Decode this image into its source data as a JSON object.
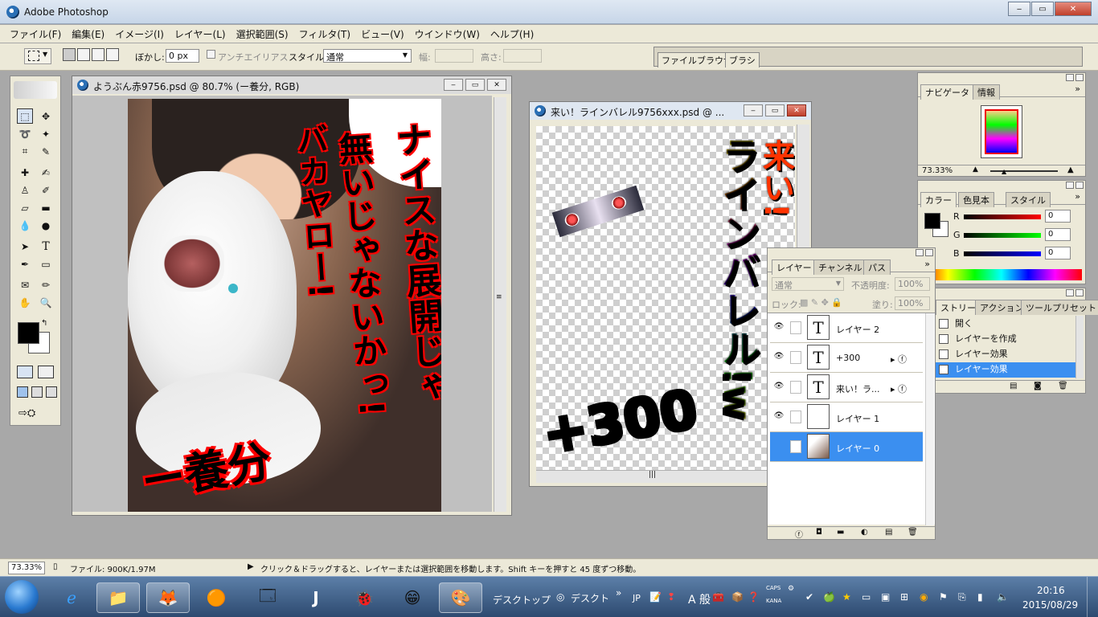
{
  "app": {
    "title": "Adobe Photoshop"
  },
  "menu": [
    "ファイル(F)",
    "編集(E)",
    "イメージ(I)",
    "レイヤー(L)",
    "選択範囲(S)",
    "フィルタ(T)",
    "ビュー(V)",
    "ウインドウ(W)",
    "ヘルプ(H)"
  ],
  "options": {
    "feather_label": "ぼかし:",
    "feather_value": "0 px",
    "antialias": "アンチエイリアス",
    "style_label": "スタイル:",
    "style_value": "通常",
    "width_label": "幅:",
    "height_label": "高さ:"
  },
  "palette_well": {
    "tab1": "ファイルブラウザ",
    "tab2": "ブラシ"
  },
  "doc1": {
    "title": "ようぶん赤9756.psd @ 80.7% (ー養分, RGB)",
    "text_main": "ナイスな展開じゃ",
    "text_2": "無いじゃないかっ!",
    "text_3": "バカヤロー!",
    "text_bottom": "ー養分"
  },
  "doc2": {
    "title": "来い！ラインバレル9756xxx.psd @ ...",
    "text_1": "来い!",
    "text_2": "ラインバレル!w",
    "text_3": "+300"
  },
  "navigator": {
    "tab1": "ナビゲータ",
    "tab2": "情報",
    "zoom": "73.33%"
  },
  "color": {
    "tab1": "カラー",
    "tab2": "色見本",
    "tab3": "スタイル",
    "r_label": "R",
    "g_label": "G",
    "b_label": "B",
    "r": "0",
    "g": "0",
    "b": "0"
  },
  "history": {
    "tab1": "ストリー",
    "tab2": "アクション",
    "tab3": "ツールプリセット",
    "items": [
      "開く",
      "レイヤーを作成",
      "レイヤー効果",
      "レイヤー効果"
    ]
  },
  "layers": {
    "tab1": "レイヤー",
    "tab2": "チャンネル",
    "tab3": "パス",
    "blend": "通常",
    "opacity_label": "不透明度:",
    "opacity": "100%",
    "lock_label": "ロック:",
    "fill_label": "塗り:",
    "fill": "100%",
    "items": [
      {
        "name": "レイヤー 2",
        "thumb": "T"
      },
      {
        "name": "+300",
        "thumb": "T"
      },
      {
        "name": "来い！ラ...",
        "thumb": "T"
      },
      {
        "name": "レイヤー 1",
        "thumb": ""
      },
      {
        "name": "レイヤー 0",
        "thumb": ""
      }
    ]
  },
  "status": {
    "zoom": "73.33%",
    "file": "ファイル: 900K/1.97M",
    "hint": "クリック＆ドラッグすると、レイヤーまたは選択範囲を移動します。Shift キーを押すと 45 度ずつ移動。"
  },
  "taskbar": {
    "desktop1": "デスクトップ",
    "desktop2": "デスクト",
    "lang": "JP",
    "ime": "A 般",
    "caps": "CAPS",
    "kana": "KANA",
    "time": "20:16",
    "date": "2015/08/29"
  }
}
